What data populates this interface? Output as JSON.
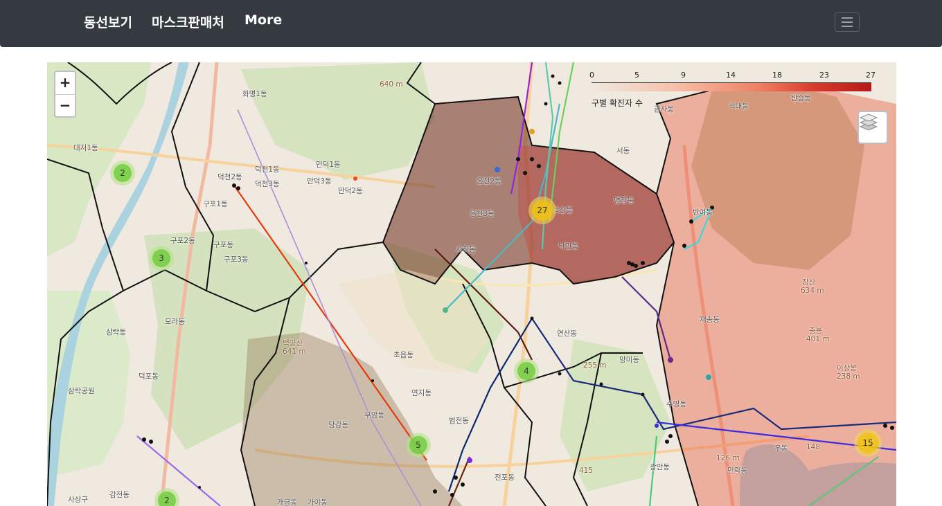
{
  "navbar": {
    "links": [
      "동선보기",
      "마스크판매처",
      "More"
    ],
    "toggler_icon": "hamburger-icon"
  },
  "map": {
    "zoom_in": "+",
    "zoom_out": "−",
    "layers_icon": "layers-icon",
    "legend": {
      "ticks": [
        "0",
        "5",
        "9",
        "14",
        "18",
        "23",
        "27"
      ],
      "caption": "구별 확진자 수",
      "color_low": "#fde8dc",
      "color_high": "#b51a1a"
    },
    "clusters": [
      "2",
      "3",
      "27",
      "4",
      "5",
      "15",
      "2"
    ],
    "place_labels": [
      "화명1동",
      "대저1동",
      "덕천1동",
      "만덕1동",
      "만덕2동",
      "만덕3동",
      "덕천2동",
      "덕천3동",
      "구포1동",
      "구포2동",
      "구포동",
      "구포3동",
      "모라동",
      "삼락동",
      "덕포동",
      "삼락공원",
      "감전동",
      "사상구",
      "온천2동",
      "온천3동",
      "사직동",
      "복산동",
      "명장동",
      "낙민동",
      "서동",
      "금사동",
      "석대동",
      "반송동",
      "반여동",
      "재송동",
      "장산",
      "634 m",
      "중봉",
      "401 m",
      "이상봉",
      "238 m",
      "연산동",
      "망미동",
      "수영동",
      "민락동",
      "광안동",
      "우동",
      "초읍동",
      "연지동",
      "범전동",
      "당감동",
      "부암동",
      "전포동",
      "개금동",
      "가야동",
      "백양산",
      "641 m",
      "640 m",
      "255 m",
      "126 m",
      "415",
      "148"
    ]
  }
}
